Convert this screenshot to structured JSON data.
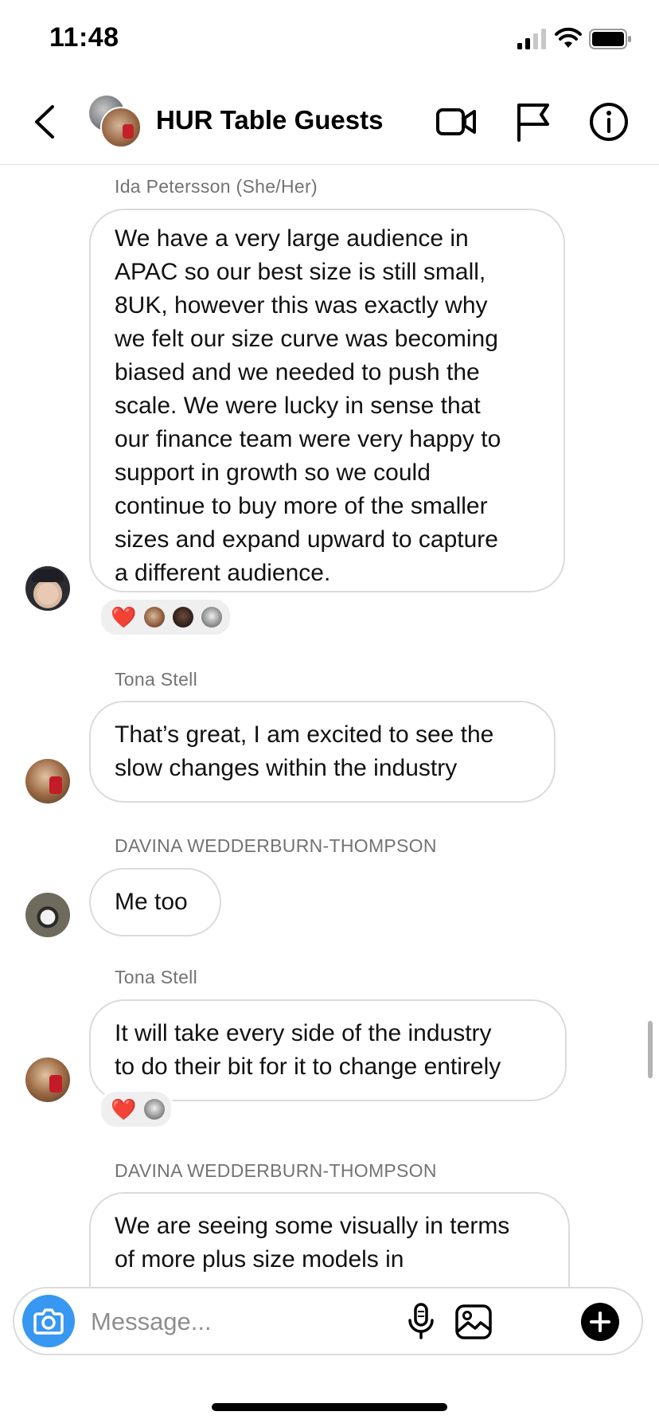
{
  "status_bar": {
    "time": "11:48"
  },
  "header": {
    "title": "HUR Table Guests"
  },
  "messages": [
    {
      "sender": "Ida Petersson (She/Her)",
      "lines": [
        "We have a very large audience in",
        "APAC so our best size is still small,",
        "8UK, however this was exactly why",
        "we felt our size curve was becoming",
        "biased and we needed to push the",
        "scale. We were lucky in sense that",
        "our finance team were very happy to",
        "support in growth so we could",
        "continue to buy more of the smaller",
        "sizes and expand upward to capture",
        "a different audience."
      ],
      "reactions": {
        "emoji": "❤️"
      }
    },
    {
      "sender": "Tona Stell",
      "lines": [
        "That’s great, I am excited to see the",
        "slow changes within the industry"
      ]
    },
    {
      "sender": "DAVINA WEDDERBURN-THOMPSON",
      "lines": [
        "Me too"
      ]
    },
    {
      "sender": "Tona Stell",
      "lines": [
        "It will take every side of the industry",
        "to do their bit for it to change entirely"
      ],
      "reactions": {
        "emoji": "❤️"
      }
    },
    {
      "sender": "DAVINA WEDDERBURN-THOMPSON",
      "lines": [
        "We are seeing some visually in terms",
        "of more plus size models in"
      ]
    }
  ],
  "composer": {
    "placeholder": "Message..."
  },
  "icons": {
    "back": "chevron-left-icon",
    "video": "video-camera-icon",
    "flag": "flag-icon",
    "info": "info-icon",
    "camera": "camera-icon",
    "mic": "microphone-icon",
    "gallery": "image-icon",
    "plus": "plus-icon"
  },
  "colors": {
    "accent": "#3897f0",
    "heart": "#e0182d",
    "bubble_border": "#dbdbdb",
    "meta_text": "#737373"
  }
}
